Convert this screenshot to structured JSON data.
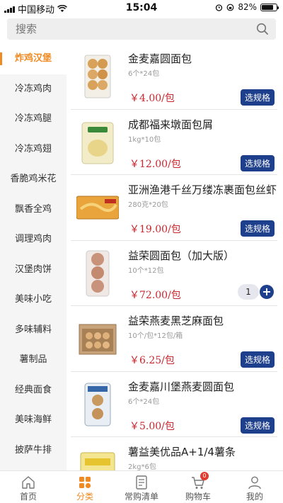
{
  "status_bar": {
    "carrier": "中国移动",
    "time": "15:04",
    "battery": "82%",
    "battery_level": 0.82
  },
  "search": {
    "placeholder": "搜索"
  },
  "sidebar": {
    "accent_color": "#f08a22",
    "items": [
      {
        "label": "炸鸡汉堡",
        "active": true
      },
      {
        "label": "冷冻鸡肉"
      },
      {
        "label": "冷冻鸡腿"
      },
      {
        "label": "冷冻鸡翅"
      },
      {
        "label": "香脆鸡米花"
      },
      {
        "label": "飘香全鸡"
      },
      {
        "label": "调理鸡肉"
      },
      {
        "label": "汉堡肉饼"
      },
      {
        "label": "美味小吃"
      },
      {
        "label": "多味辅料"
      },
      {
        "label": "薯制品"
      },
      {
        "label": "经典面食"
      },
      {
        "label": "美味海鲜"
      },
      {
        "label": "披萨牛排"
      }
    ]
  },
  "products": [
    {
      "name": "金麦嘉圆面包",
      "spec": "6个*24包",
      "price": "￥4.00/包",
      "action": "选规格"
    },
    {
      "name": "成都福来墩面包屑",
      "spec": "1kg*10包",
      "price": "￥12.00/包",
      "action": "选规格"
    },
    {
      "name": "亚洲渔港千丝万缕冻裹面包丝虾",
      "spec": "280克*20包",
      "price": "￥19.00/包",
      "action": "选规格"
    },
    {
      "name": "益荣圆面包（加大版）",
      "spec": "10个*12包",
      "price": "￥72.00/包",
      "quantity": "1",
      "plus": "+"
    },
    {
      "name": "益荣燕麦黑芝麻面包",
      "spec": "10个/包*12包/箱",
      "price": "￥6.25/包",
      "action": "选规格"
    },
    {
      "name": "金麦嘉川堡燕麦圆面包",
      "spec": "6个*24包",
      "price": "￥5.00/包",
      "action": "选规格"
    },
    {
      "name": "薯益美优品A+1/4薯条",
      "spec": "2kg*6包"
    }
  ],
  "tabbar": {
    "items": [
      {
        "label": "首页",
        "icon": "home-icon"
      },
      {
        "label": "分类",
        "icon": "category-icon",
        "active": true
      },
      {
        "label": "常购清单",
        "icon": "list-icon"
      },
      {
        "label": "购物车",
        "icon": "cart-icon",
        "badge": "0"
      },
      {
        "label": "我的",
        "icon": "user-icon"
      }
    ]
  },
  "colors": {
    "accent": "#f08a22",
    "price": "#c8272e",
    "button": "#1e3f8c"
  }
}
